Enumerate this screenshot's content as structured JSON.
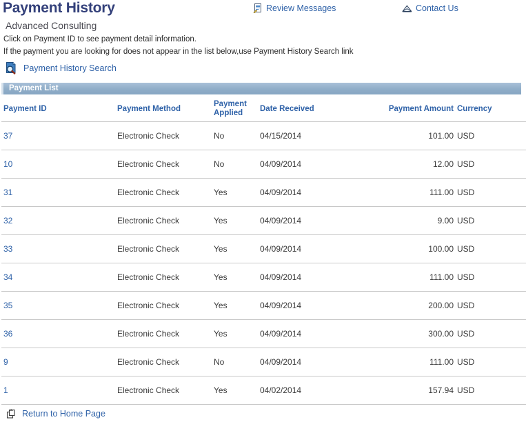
{
  "header": {
    "title": "Payment History",
    "org_name": "Advanced Consulting",
    "instruction_1": "Click on Payment ID to see payment detail information.",
    "instruction_2": "If the payment you are looking for does not appear in the list below,use Payment History Search link",
    "links": {
      "review_messages": "Review Messages",
      "contact_us": "Contact Us",
      "payment_history_search": "Payment History Search"
    },
    "icons": {
      "review_messages": "note-pencil-icon",
      "contact_us": "envelope-icon",
      "payment_history_search": "document-search-icon"
    }
  },
  "payment_list": {
    "section_title": "Payment List",
    "columns": [
      "Payment ID",
      "Payment Method",
      "Payment Applied",
      "Date Received",
      "Payment Amount",
      "Currency"
    ],
    "column_applied_line1": "Payment",
    "column_applied_line2": "Applied",
    "rows": [
      {
        "payment_id": "37",
        "payment_method": "Electronic Check",
        "payment_applied": "No",
        "date_received": "04/15/2014",
        "payment_amount": "101.00",
        "currency": "USD"
      },
      {
        "payment_id": "10",
        "payment_method": "Electronic Check",
        "payment_applied": "No",
        "date_received": "04/09/2014",
        "payment_amount": "12.00",
        "currency": "USD"
      },
      {
        "payment_id": "31",
        "payment_method": "Electronic Check",
        "payment_applied": "Yes",
        "date_received": "04/09/2014",
        "payment_amount": "111.00",
        "currency": "USD"
      },
      {
        "payment_id": "32",
        "payment_method": "Electronic Check",
        "payment_applied": "Yes",
        "date_received": "04/09/2014",
        "payment_amount": "9.00",
        "currency": "USD"
      },
      {
        "payment_id": "33",
        "payment_method": "Electronic Check",
        "payment_applied": "Yes",
        "date_received": "04/09/2014",
        "payment_amount": "100.00",
        "currency": "USD"
      },
      {
        "payment_id": "34",
        "payment_method": "Electronic Check",
        "payment_applied": "Yes",
        "date_received": "04/09/2014",
        "payment_amount": "111.00",
        "currency": "USD"
      },
      {
        "payment_id": "35",
        "payment_method": "Electronic Check",
        "payment_applied": "Yes",
        "date_received": "04/09/2014",
        "payment_amount": "200.00",
        "currency": "USD"
      },
      {
        "payment_id": "36",
        "payment_method": "Electronic Check",
        "payment_applied": "Yes",
        "date_received": "04/09/2014",
        "payment_amount": "300.00",
        "currency": "USD"
      },
      {
        "payment_id": "9",
        "payment_method": "Electronic Check",
        "payment_applied": "No",
        "date_received": "04/09/2014",
        "payment_amount": "111.00",
        "currency": "USD"
      },
      {
        "payment_id": "1",
        "payment_method": "Electronic Check",
        "payment_applied": "Yes",
        "date_received": "04/02/2014",
        "payment_amount": "157.94",
        "currency": "USD"
      }
    ]
  },
  "footer": {
    "return_home": "Return to Home Page",
    "return_home_icon": "home-return-icon"
  },
  "colors": {
    "title": "#33407a",
    "link": "#2f62a8",
    "section_bar": "#8fadc8",
    "row_border": "#c8c8c8",
    "text": "#3a3a3a"
  }
}
